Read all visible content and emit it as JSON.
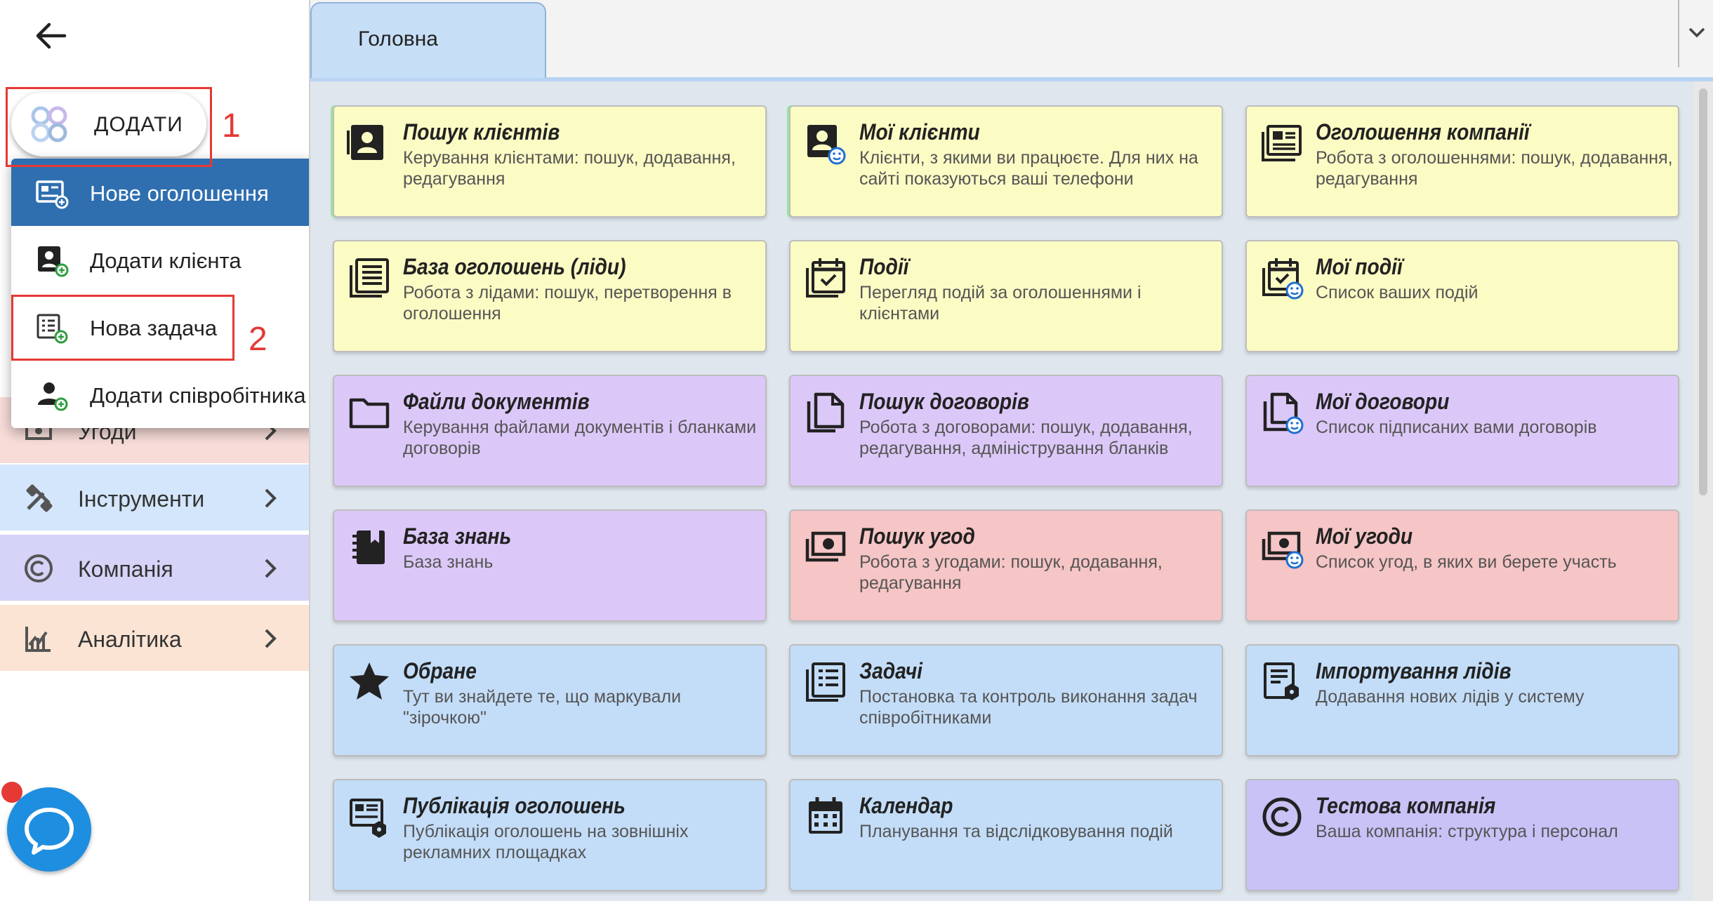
{
  "sidebar": {
    "add_label": "ДОДАТИ",
    "nav": [
      {
        "label": "Угоди",
        "icon": "deals-icon",
        "bg": "#f7dcd8"
      },
      {
        "label": "Інструменти",
        "icon": "tools-icon",
        "bg": "#d3e6fb"
      },
      {
        "label": "Компанія",
        "icon": "copyright-icon",
        "bg": "#d6d3f8"
      },
      {
        "label": "Аналітика",
        "icon": "analytics-icon",
        "bg": "#fbe4d4"
      }
    ]
  },
  "add_menu": {
    "items": [
      {
        "label": "Нове оголошення",
        "icon": "listing-add-icon"
      },
      {
        "label": "Додати клієнта",
        "icon": "client-add-icon"
      },
      {
        "label": "Нова задача",
        "icon": "task-add-icon"
      },
      {
        "label": "Додати співробітника",
        "icon": "employee-add-icon"
      }
    ]
  },
  "annotations": {
    "first": "1",
    "second": "2"
  },
  "tabs": {
    "home": "Головна"
  },
  "tiles": [
    {
      "title": "Пошук клієнтів",
      "desc": "Керування клієнтами: пошук, додавання, редагування",
      "icon": "contact-card-icon"
    },
    {
      "title": "Мої клієнти",
      "desc": "Клієнти, з якими ви працюєте. Для них на сайті показуються ваші телефони",
      "icon": "my-contact-card-icon"
    },
    {
      "title": "Оголошення компанії",
      "desc": "Робота з оголошеннями: пошук, додавання, редагування",
      "icon": "listings-icon"
    },
    {
      "title": "База оголошень (ліди)",
      "desc": "Робота з лідами: пошук, перетворення в оголошення",
      "icon": "listing-base-icon"
    },
    {
      "title": "Події",
      "desc": "Перегляд подій за оголошеннями і клієнтами",
      "icon": "calendar-check-icon"
    },
    {
      "title": "Мої події",
      "desc": "Список ваших подій",
      "icon": "my-calendar-check-icon"
    },
    {
      "title": "Файли документів",
      "desc": "Керування файлами документів і бланками договорів",
      "icon": "folder-icon"
    },
    {
      "title": "Пошук договорів",
      "desc": "Робота з договорами: пошук, додавання, редагування, адміністрування бланків",
      "icon": "documents-icon"
    },
    {
      "title": "Мої договори",
      "desc": "Список підписаних вами договорів",
      "icon": "my-documents-icon"
    },
    {
      "title": "База знань",
      "desc": "База знань",
      "icon": "notebook-icon"
    },
    {
      "title": "Пошук угод",
      "desc": "Робота з угодами: пошук, додавання, редагування",
      "icon": "money-icon"
    },
    {
      "title": "Мої угоди",
      "desc": "Список угод, в яких ви берете участь",
      "icon": "my-money-icon"
    },
    {
      "title": "Обране",
      "desc": "Тут ви знайдете те, що маркували \"зірочкою\"",
      "icon": "star-icon"
    },
    {
      "title": "Задачі",
      "desc": "Постановка та контроль виконання задач співробітниками",
      "icon": "tasks-icon"
    },
    {
      "title": "Імпортування лідів",
      "desc": "Додавання нових лідів у систему",
      "icon": "import-icon"
    },
    {
      "title": "Публікація оголошень",
      "desc": "Публікація оголошень на зовнішніх рекламних площадках",
      "icon": "publish-icon"
    },
    {
      "title": "Календар",
      "desc": "Планування та відслідковування подій",
      "icon": "calendar-icon"
    },
    {
      "title": "Тестова компанія",
      "desc": "Ваша компанія: структура і персонал",
      "icon": "company-icon"
    }
  ]
}
